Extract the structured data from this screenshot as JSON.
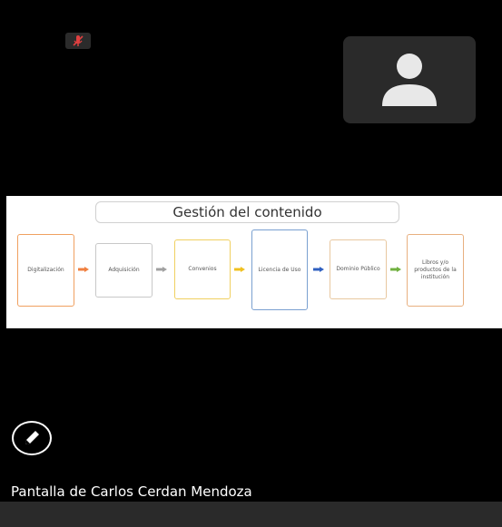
{
  "slide": {
    "title": "Gestión del contenido",
    "steps": [
      "Digitalización",
      "Adquisición",
      "Convenios",
      "Licencia de Uso",
      "Dominio Público",
      "Libros y/o productos de la institución"
    ],
    "step_colors": [
      "#f0a060",
      "#c8c8c8",
      "#f0d060",
      "#7aa0d0",
      "#e8c8a0",
      "#e8b080"
    ],
    "arrow_colors": [
      "#f08040",
      "#a0a0a0",
      "#f0c020",
      "#3060c0",
      "#70b040"
    ]
  },
  "share": {
    "label": "Pantalla de Carlos Cerdan Mendoza"
  },
  "icons": {
    "mic": "mic-muted-icon",
    "avatar": "person-avatar-icon",
    "pen": "pen-icon"
  }
}
